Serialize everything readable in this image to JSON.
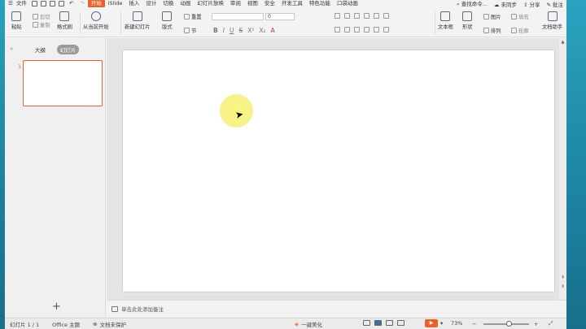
{
  "menu": {
    "file_label": "文件",
    "tabs": [
      "开始",
      "iSlide",
      "插入",
      "设计",
      "切换",
      "动画",
      "幻灯片放映",
      "审阅",
      "视图",
      "安全",
      "开发工具",
      "特色功能",
      "口袋动画"
    ],
    "active_tab": "开始",
    "search_label": "查找命令...",
    "sync_label": "未同步",
    "share_label": "分享",
    "comment_label": "批注"
  },
  "ribbon": {
    "paste": "粘贴",
    "cut": "剪切",
    "copy": "复制",
    "format_painter": "格式刷",
    "from_current": "从当前开始",
    "new_slide": "新建幻灯片",
    "layout": "版式",
    "section": "节",
    "reset": "重置",
    "font_size": "0",
    "text_box": "文本框",
    "shape": "形状",
    "arrange": "排列",
    "picture": "图片",
    "fill": "填充",
    "outline": "轮廓",
    "doc_assistant": "文档助手",
    "format_glyphs": [
      "B",
      "I",
      "U",
      "S",
      "X²",
      "X₂",
      "A"
    ]
  },
  "left_panel": {
    "tab_outline": "大纲",
    "tab_slides": "幻灯片",
    "slide_number": "1"
  },
  "notes": {
    "placeholder": "单击此处添加备注"
  },
  "status": {
    "slide_counter": "幻灯片 1 / 1",
    "theme": "Office 主题",
    "protection": "文档未保护",
    "beautify": "一键美化",
    "zoom": "73%"
  }
}
